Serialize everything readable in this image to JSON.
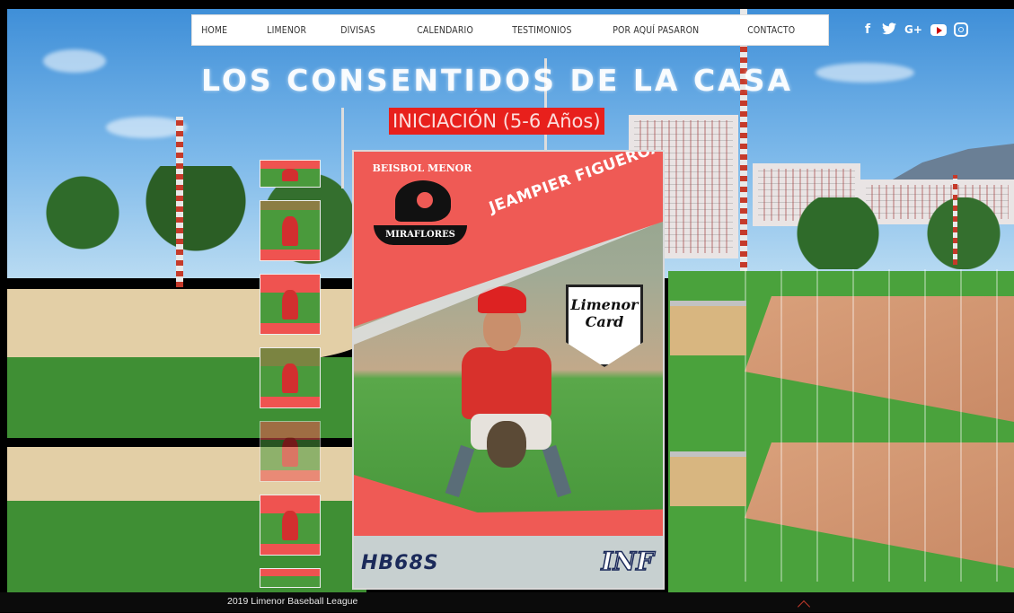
{
  "nav": {
    "items": [
      {
        "label": "HOME"
      },
      {
        "label": "LIMENOR"
      },
      {
        "label": "DIVISAS"
      },
      {
        "label": "CALENDARIO"
      },
      {
        "label": "TESTIMONIOS"
      },
      {
        "label": "POR AQUÍ PASARON"
      },
      {
        "label": "CONTACTO"
      }
    ]
  },
  "social": {
    "facebook": "f",
    "twitter": "🐦",
    "google_plus": "G+",
    "icons": [
      "facebook-icon",
      "twitter-icon",
      "google-plus-icon",
      "youtube-icon",
      "instagram-icon"
    ]
  },
  "hero": {
    "headline": "LOS CONSENTIDOS DE LA CASA",
    "subtitle": "INICIACIÓN (5-6 Años)"
  },
  "card": {
    "league_top": "BEISBOL MENOR",
    "league_bottom": "MIRAFLORES",
    "player_name": "JEAMPIER FIGUEROA",
    "badge_line1": "Limenor",
    "badge_line2": "Card",
    "code": "HB68S",
    "category": "INF"
  },
  "gallery": {
    "thumbnail_count": 7
  },
  "footer": {
    "text": "2019 Limenor Baseball League"
  },
  "colors": {
    "accent_red": "#e8201c",
    "card_red": "#ef5a55",
    "nav_bg": "#ffffff",
    "footer_bg": "#0b0b0b"
  }
}
